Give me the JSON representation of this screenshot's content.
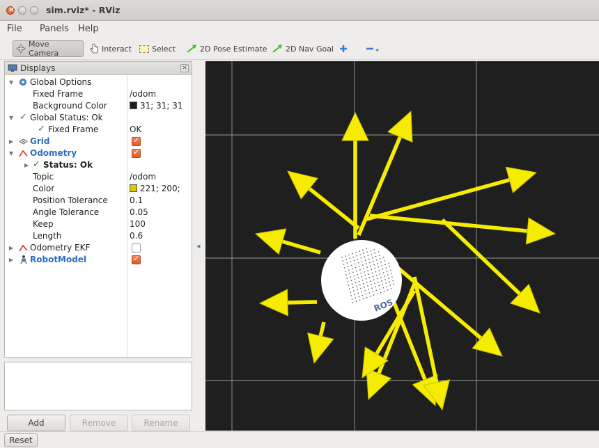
{
  "window": {
    "title": "sim.rviz* - RViz"
  },
  "menu": [
    "File",
    "Panels",
    "Help"
  ],
  "toolbar": {
    "move_camera": "Move Camera",
    "interact": "Interact",
    "select": "Select",
    "pose_estimate": "2D Pose Estimate",
    "nav_goal": "2D Nav Goal"
  },
  "displays": {
    "title": "Displays",
    "rows": [
      {
        "key": "Global Options",
        "value": ""
      },
      {
        "key": "Fixed Frame",
        "value": "/odom"
      },
      {
        "key": "Background Color",
        "value": "31; 31; 31"
      },
      {
        "key": "Global Status: Ok",
        "value": ""
      },
      {
        "key": "Fixed Frame",
        "value": "OK"
      },
      {
        "key": "Grid",
        "value": ""
      },
      {
        "key": "Odometry",
        "value": ""
      },
      {
        "key": "Status: Ok",
        "value": ""
      },
      {
        "key": "Topic",
        "value": "/odom"
      },
      {
        "key": "Color",
        "value": "221; 200;"
      },
      {
        "key": "Position Tolerance",
        "value": "0.1"
      },
      {
        "key": "Angle Tolerance",
        "value": "0.05"
      },
      {
        "key": "Keep",
        "value": "100"
      },
      {
        "key": "Length",
        "value": "0.6"
      },
      {
        "key": "Odometry EKF",
        "value": ""
      },
      {
        "key": "RobotModel",
        "value": ""
      }
    ],
    "enabled": {
      "grid": true,
      "odometry": true,
      "odometry_ekf": false,
      "robot_model": true
    }
  },
  "buttons": {
    "add": "Add",
    "remove": "Remove",
    "rename": "Rename",
    "reset": "Reset"
  },
  "colors": {
    "background": "#1f1f1f",
    "odometry_swatch": "#ddc800",
    "arrow": "#f5ec00",
    "grid": "#a0a0a0",
    "robot_logo": "ROS"
  },
  "robot_label": "ROS"
}
